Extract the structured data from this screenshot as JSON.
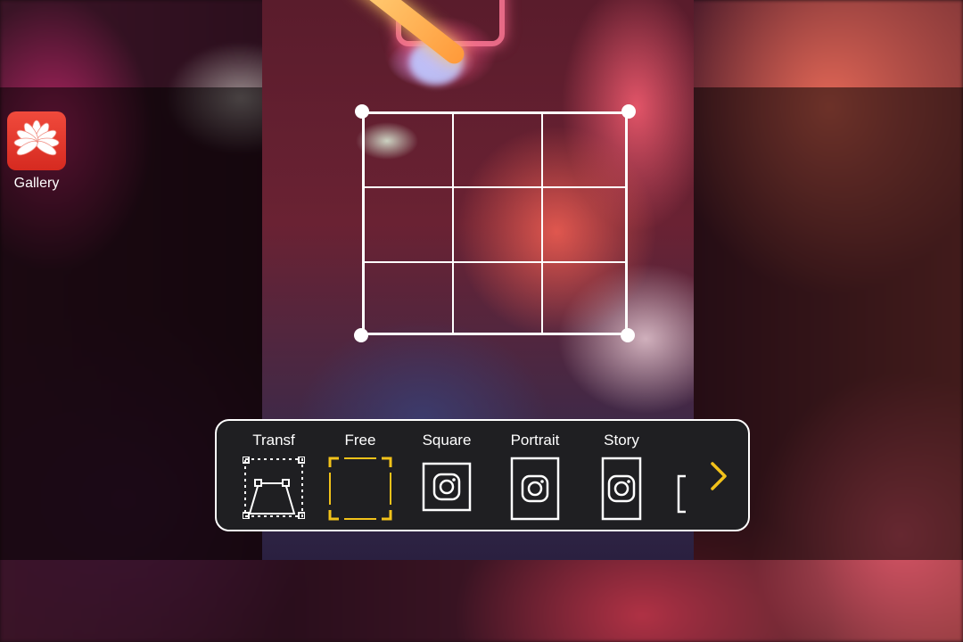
{
  "desktop": {
    "gallery_app_label": "Gallery"
  },
  "crop_toolbar": {
    "options": [
      {
        "label": "Transf",
        "icon": "perspective-transform-icon"
      },
      {
        "label": "Free",
        "icon": "free-crop-icon",
        "selected": true
      },
      {
        "label": "Square",
        "icon": "instagram-square-icon"
      },
      {
        "label": "Portrait",
        "icon": "instagram-portrait-icon"
      },
      {
        "label": "Story",
        "icon": "instagram-story-icon"
      }
    ],
    "next_icon": "chevron-right-icon"
  },
  "colors": {
    "accent": "#f2c21a",
    "toolbar_bg": "#1f1f22",
    "icon_stroke": "#ffffff",
    "gallery_icon": "#e2352a"
  }
}
